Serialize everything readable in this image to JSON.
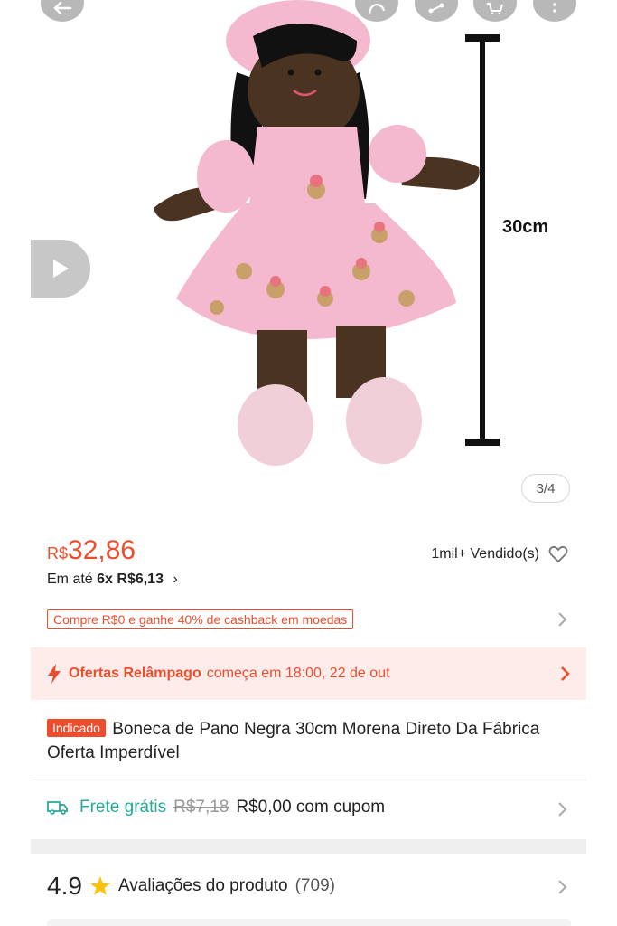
{
  "hero": {
    "image_alt": "Boneca de pano negra com vestido rosa de cupcakes",
    "dimension_label": "30cm",
    "counter": "3/4",
    "icons": [
      "back-icon",
      "whatsapp-share-icon",
      "share-icon",
      "cart-icon",
      "more-icon",
      "play-icon"
    ]
  },
  "price": {
    "currency": "R$",
    "value": "32,86",
    "installments_prefix": "Em até",
    "installments_bold": "6x R$6,13",
    "installments_chevron": "›",
    "sold": "1mil+ Vendido(s)"
  },
  "cashback": {
    "label": "Compre R$0 e ganhe 40% de cashback em moedas"
  },
  "flash": {
    "title": "Ofertas Relâmpago",
    "when": "começa em 18:00, 22 de out"
  },
  "product": {
    "tag": "Indicado",
    "title": "Boneca de Pano Negra 30cm Morena Direto Da Fábrica Oferta Imperdível"
  },
  "shipping": {
    "free_label": "Frete grátis",
    "old_price": "R$7,18",
    "new_price": "R$0,00 com cupom"
  },
  "rating": {
    "score": "4.9",
    "label": "Avaliações do produto",
    "count": "(709)"
  },
  "colors": {
    "brand": "#ee4d2d",
    "shipping": "#26aa99",
    "flash_bg": "#fdecea",
    "star": "#ffc107"
  }
}
